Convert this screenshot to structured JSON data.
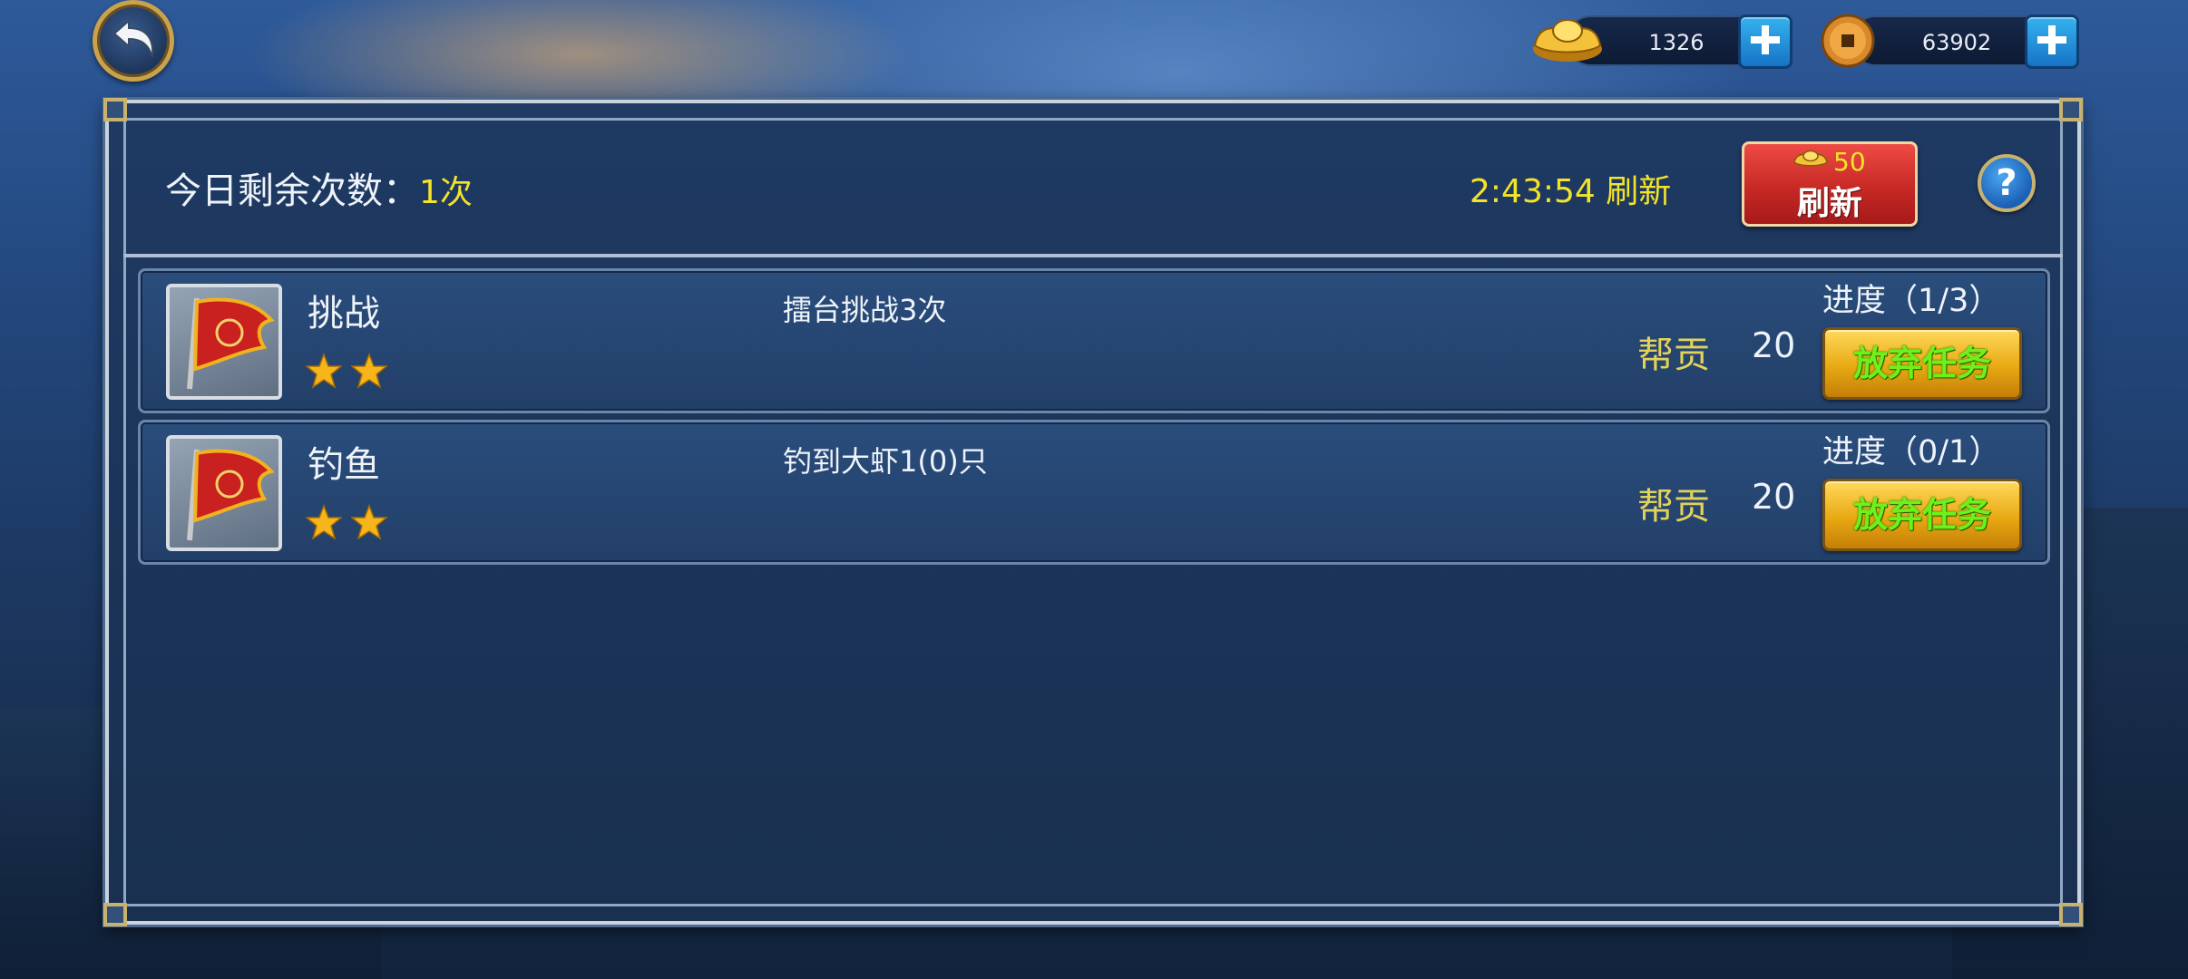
{
  "topbar": {
    "gold": {
      "icon": "gold-ingot-icon",
      "value": "1326"
    },
    "coins": {
      "icon": "copper-coin-icon",
      "value": "63902"
    }
  },
  "header": {
    "remaining_label": "今日剩余次数：",
    "remaining_value": "1次",
    "refresh_timer": "2:43:54 刷新",
    "refresh_button": {
      "cost": "50",
      "label": "刷新"
    },
    "help_label": "?"
  },
  "tasks": [
    {
      "name": "挑战",
      "stars": 2,
      "description": "擂台挑战3次",
      "reward_label": "帮贡",
      "reward_value": "20",
      "progress": "进度（1/3）",
      "action": "放弃任务"
    },
    {
      "name": "钓鱼",
      "stars": 2,
      "description": "钓到大虾1(0)只",
      "reward_label": "帮贡",
      "reward_value": "20",
      "progress": "进度（0/1）",
      "action": "放弃任务"
    }
  ],
  "colors": {
    "accent_yellow": "#f3e32b",
    "reward_gold": "#e3d25a",
    "refresh_red": "#c72925",
    "abandon_text_green": "#6cf21a"
  }
}
